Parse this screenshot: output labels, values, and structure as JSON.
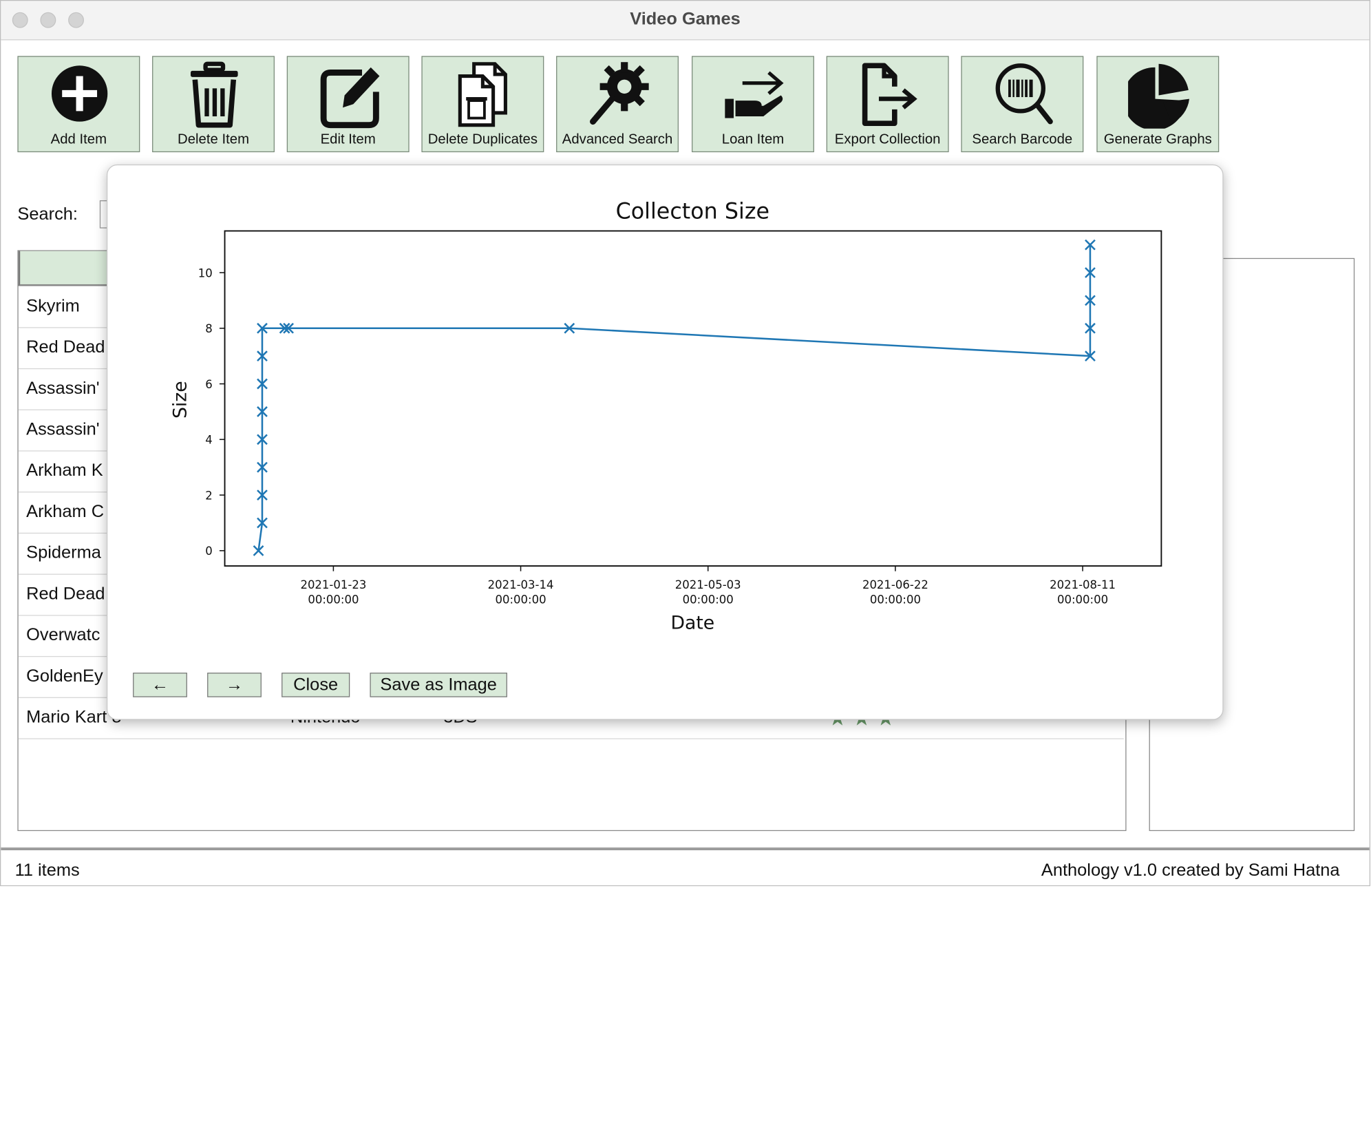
{
  "window": {
    "title": "Video Games"
  },
  "toolbar": [
    {
      "label": "Add Item",
      "icon": "plus-circle-icon"
    },
    {
      "label": "Delete Item",
      "icon": "trash-icon"
    },
    {
      "label": "Edit Item",
      "icon": "edit-icon"
    },
    {
      "label": "Delete Duplicates",
      "icon": "duplicate-delete-icon"
    },
    {
      "label": "Advanced Search",
      "icon": "gear-search-icon"
    },
    {
      "label": "Loan Item",
      "icon": "hand-arrow-icon"
    },
    {
      "label": "Export Collection",
      "icon": "file-export-icon"
    },
    {
      "label": "Search Barcode",
      "icon": "barcode-search-icon"
    },
    {
      "label": "Generate Graphs",
      "icon": "pie-chart-icon"
    }
  ],
  "search": {
    "label": "Search:"
  },
  "table": {
    "rows": [
      {
        "title": "Skyrim"
      },
      {
        "title": "Red Dead"
      },
      {
        "title": "Assassin'"
      },
      {
        "title": "Assassin'"
      },
      {
        "title": "Arkham K"
      },
      {
        "title": "Arkham C"
      },
      {
        "title": "Spiderma"
      },
      {
        "title": "Red Dead"
      },
      {
        "title": "Overwatc"
      },
      {
        "title": "GoldenEy"
      },
      {
        "title": "Mario Kart 8",
        "publisher": "Nintendo",
        "platform": "3DS",
        "stars": "★★★"
      }
    ]
  },
  "status": {
    "count": "11 items",
    "credit": "Anthology v1.0 created by Sami Hatna"
  },
  "popover": {
    "prev_label": "←",
    "next_label": "→",
    "close_label": "Close",
    "save_label": "Save as Image"
  },
  "chart_data": {
    "type": "line",
    "title": "Collecton Size",
    "xlabel": "Date",
    "ylabel": "Size",
    "marker": "x",
    "color": "#1f77b4",
    "x_ticks": [
      "2021-01-23\n00:00:00",
      "2021-03-14\n00:00:00",
      "2021-05-03\n00:00:00",
      "2021-06-22\n00:00:00",
      "2021-08-11\n00:00:00"
    ],
    "y_ticks": [
      0,
      2,
      4,
      6,
      8,
      10
    ],
    "xlim": [
      "2020-12-25",
      "2021-09-01"
    ],
    "ylim": [
      -0.55,
      11.5
    ],
    "points": [
      {
        "x": "2021-01-03",
        "y": 0
      },
      {
        "x": "2021-01-04",
        "y": 1
      },
      {
        "x": "2021-01-04",
        "y": 2
      },
      {
        "x": "2021-01-04",
        "y": 3
      },
      {
        "x": "2021-01-04",
        "y": 4
      },
      {
        "x": "2021-01-04",
        "y": 5
      },
      {
        "x": "2021-01-04",
        "y": 6
      },
      {
        "x": "2021-01-04",
        "y": 7
      },
      {
        "x": "2021-01-04",
        "y": 8
      },
      {
        "x": "2021-01-10",
        "y": 8
      },
      {
        "x": "2021-01-11",
        "y": 8
      },
      {
        "x": "2021-03-27",
        "y": 8
      },
      {
        "x": "2021-08-13",
        "y": 7
      },
      {
        "x": "2021-08-13",
        "y": 8
      },
      {
        "x": "2021-08-13",
        "y": 9
      },
      {
        "x": "2021-08-13",
        "y": 10
      },
      {
        "x": "2021-08-13",
        "y": 11
      }
    ]
  }
}
